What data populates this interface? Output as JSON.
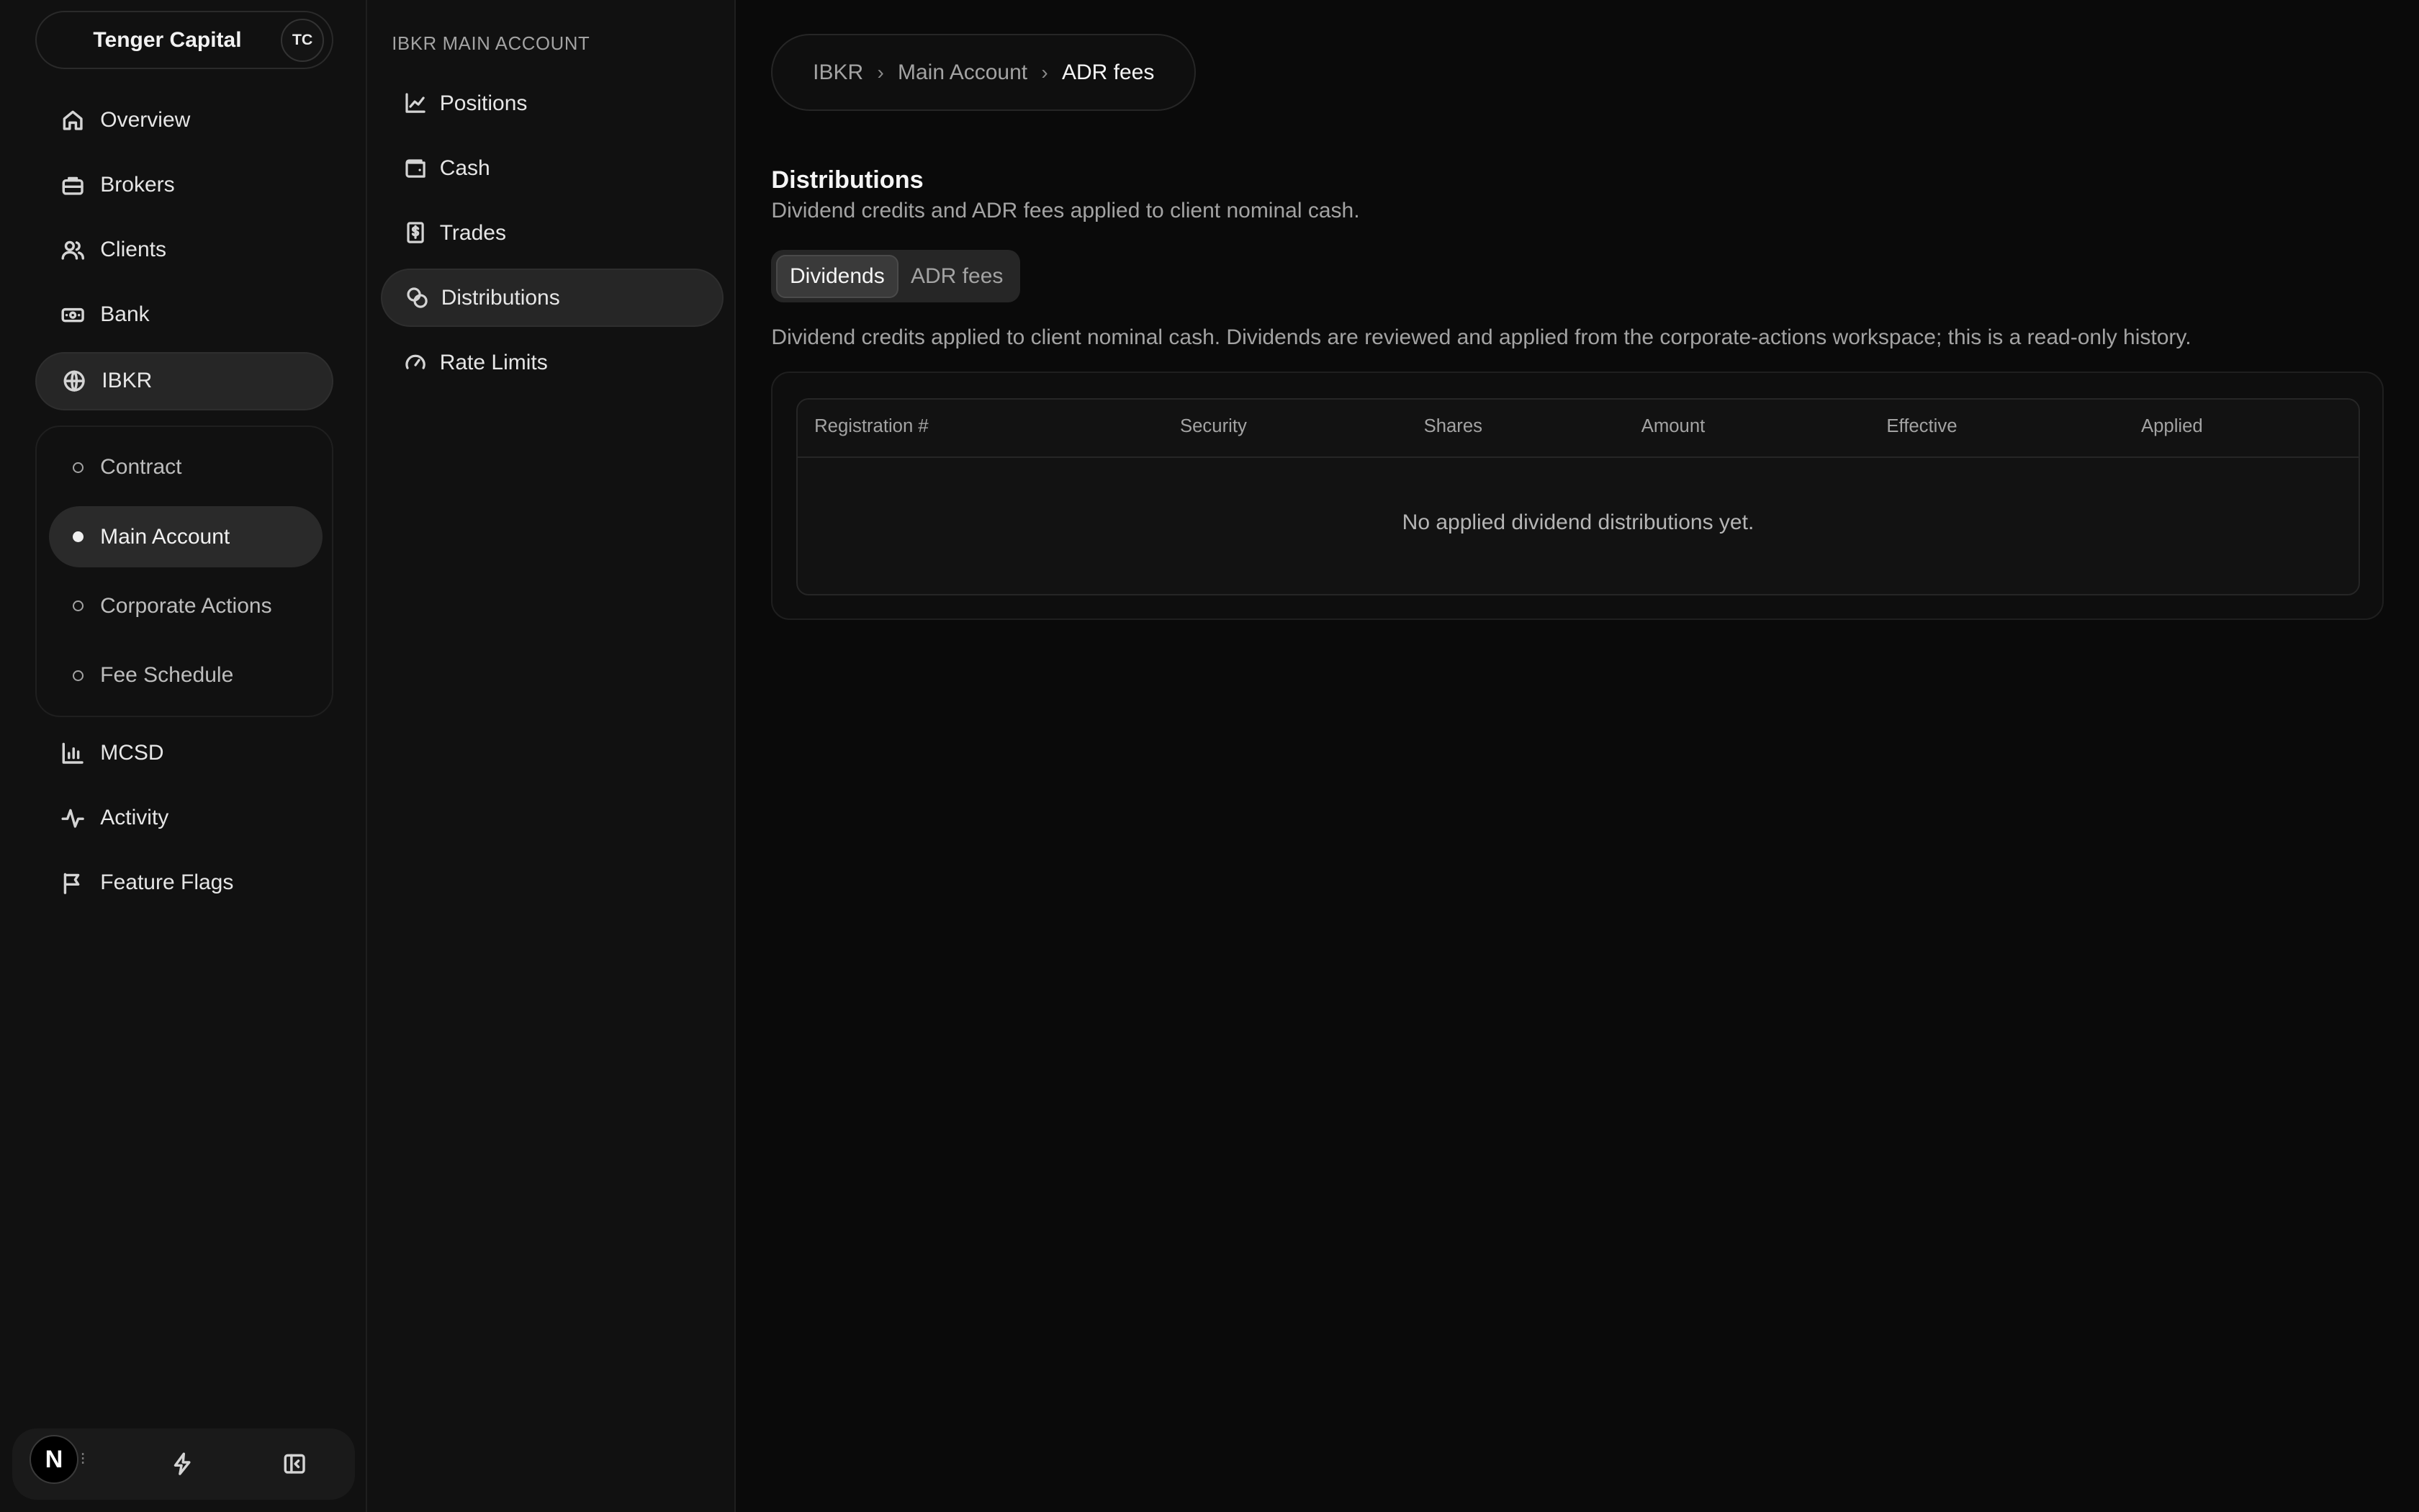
{
  "org": {
    "name": "Tenger Capital",
    "avatar_initials": "TC"
  },
  "sidebar": {
    "items": [
      {
        "label": "Overview",
        "icon": "home-icon"
      },
      {
        "label": "Brokers",
        "icon": "briefcase-icon"
      },
      {
        "label": "Clients",
        "icon": "users-icon"
      },
      {
        "label": "Bank",
        "icon": "banknote-icon"
      },
      {
        "label": "IBKR",
        "icon": "globe-icon",
        "active": true
      },
      {
        "label": "MCSD",
        "icon": "bar-chart-icon"
      },
      {
        "label": "Activity",
        "icon": "activity-icon"
      },
      {
        "label": "Feature Flags",
        "icon": "flag-icon"
      }
    ],
    "ibkr_sub": [
      {
        "label": "Contract"
      },
      {
        "label": "Main Account",
        "active": true
      },
      {
        "label": "Corporate Actions"
      },
      {
        "label": "Fee Schedule"
      }
    ],
    "footer": {
      "logo_letter": "N",
      "icons": [
        "bolt-icon",
        "collapse-sidebar-icon"
      ]
    }
  },
  "subnav": {
    "heading": "IBKR MAIN ACCOUNT",
    "items": [
      {
        "label": "Positions",
        "icon": "line-chart-icon"
      },
      {
        "label": "Cash",
        "icon": "wallet-icon"
      },
      {
        "label": "Trades",
        "icon": "dollar-receipt-icon"
      },
      {
        "label": "Distributions",
        "icon": "coins-icon",
        "active": true
      },
      {
        "label": "Rate Limits",
        "icon": "gauge-icon"
      }
    ]
  },
  "breadcrumb": [
    "IBKR",
    "Main Account",
    "ADR fees"
  ],
  "main": {
    "title": "Distributions",
    "description": "Dividend credits and ADR fees applied to client nominal cash.",
    "tabs": [
      {
        "label": "Dividends",
        "active": true
      },
      {
        "label": "ADR fees"
      }
    ],
    "tab_description": "Dividend credits applied to client nominal cash. Dividends are reviewed and applied from the corporate-actions workspace; this is a read-only history.",
    "table": {
      "columns": [
        "Registration #",
        "Security",
        "Shares",
        "Amount",
        "Effective",
        "Applied"
      ],
      "empty_message": "No applied dividend distributions yet."
    }
  }
}
